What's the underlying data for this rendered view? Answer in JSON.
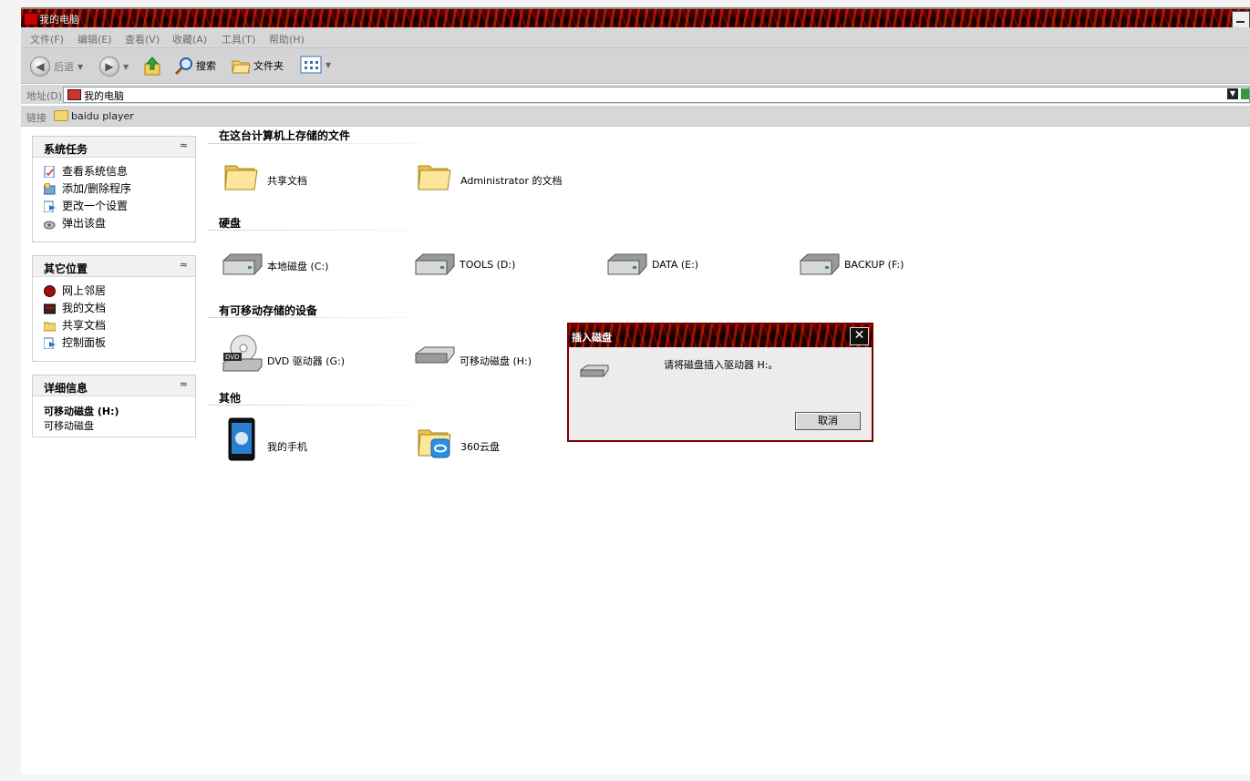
{
  "window": {
    "title": "我的电脑"
  },
  "menu": [
    "文件(F)",
    "编辑(E)",
    "查看(V)",
    "收藏(A)",
    "工具(T)",
    "帮助(H)"
  ],
  "toolbar": {
    "back": "后退",
    "search": "搜索",
    "folders": "文件夹"
  },
  "address": {
    "label": "地址(D)",
    "value": "我的电脑"
  },
  "links": {
    "label": "链接",
    "item": "baidu player"
  },
  "sidebar": {
    "system_tasks": {
      "title": "系统任务",
      "items": [
        "查看系统信息",
        "添加/删除程序",
        "更改一个设置",
        "弹出该盘"
      ]
    },
    "other_places": {
      "title": "其它位置",
      "items": [
        "网上邻居",
        "我的文档",
        "共享文档",
        "控制面板"
      ]
    },
    "details": {
      "title": "详细信息",
      "name": "可移动磁盘 (H:)",
      "type": "可移动磁盘"
    }
  },
  "sections": {
    "files": {
      "title": "在这台计算机上存储的文件",
      "items": [
        "共享文档",
        "Administrator 的文档"
      ]
    },
    "hard_disks": {
      "title": "硬盘",
      "items": [
        "本地磁盘 (C:)",
        "TOOLS (D:)",
        "DATA (E:)",
        "BACKUP (F:)"
      ]
    },
    "removable": {
      "title": "有可移动存储的设备",
      "items": [
        "DVD 驱动器 (G:)",
        "可移动磁盘 (H:)"
      ]
    },
    "other": {
      "title": "其他",
      "items": [
        "我的手机",
        "360云盘"
      ]
    }
  },
  "dialog": {
    "title": "插入磁盘",
    "message": "请将磁盘插入驱动器 H:。",
    "cancel": "取消"
  }
}
